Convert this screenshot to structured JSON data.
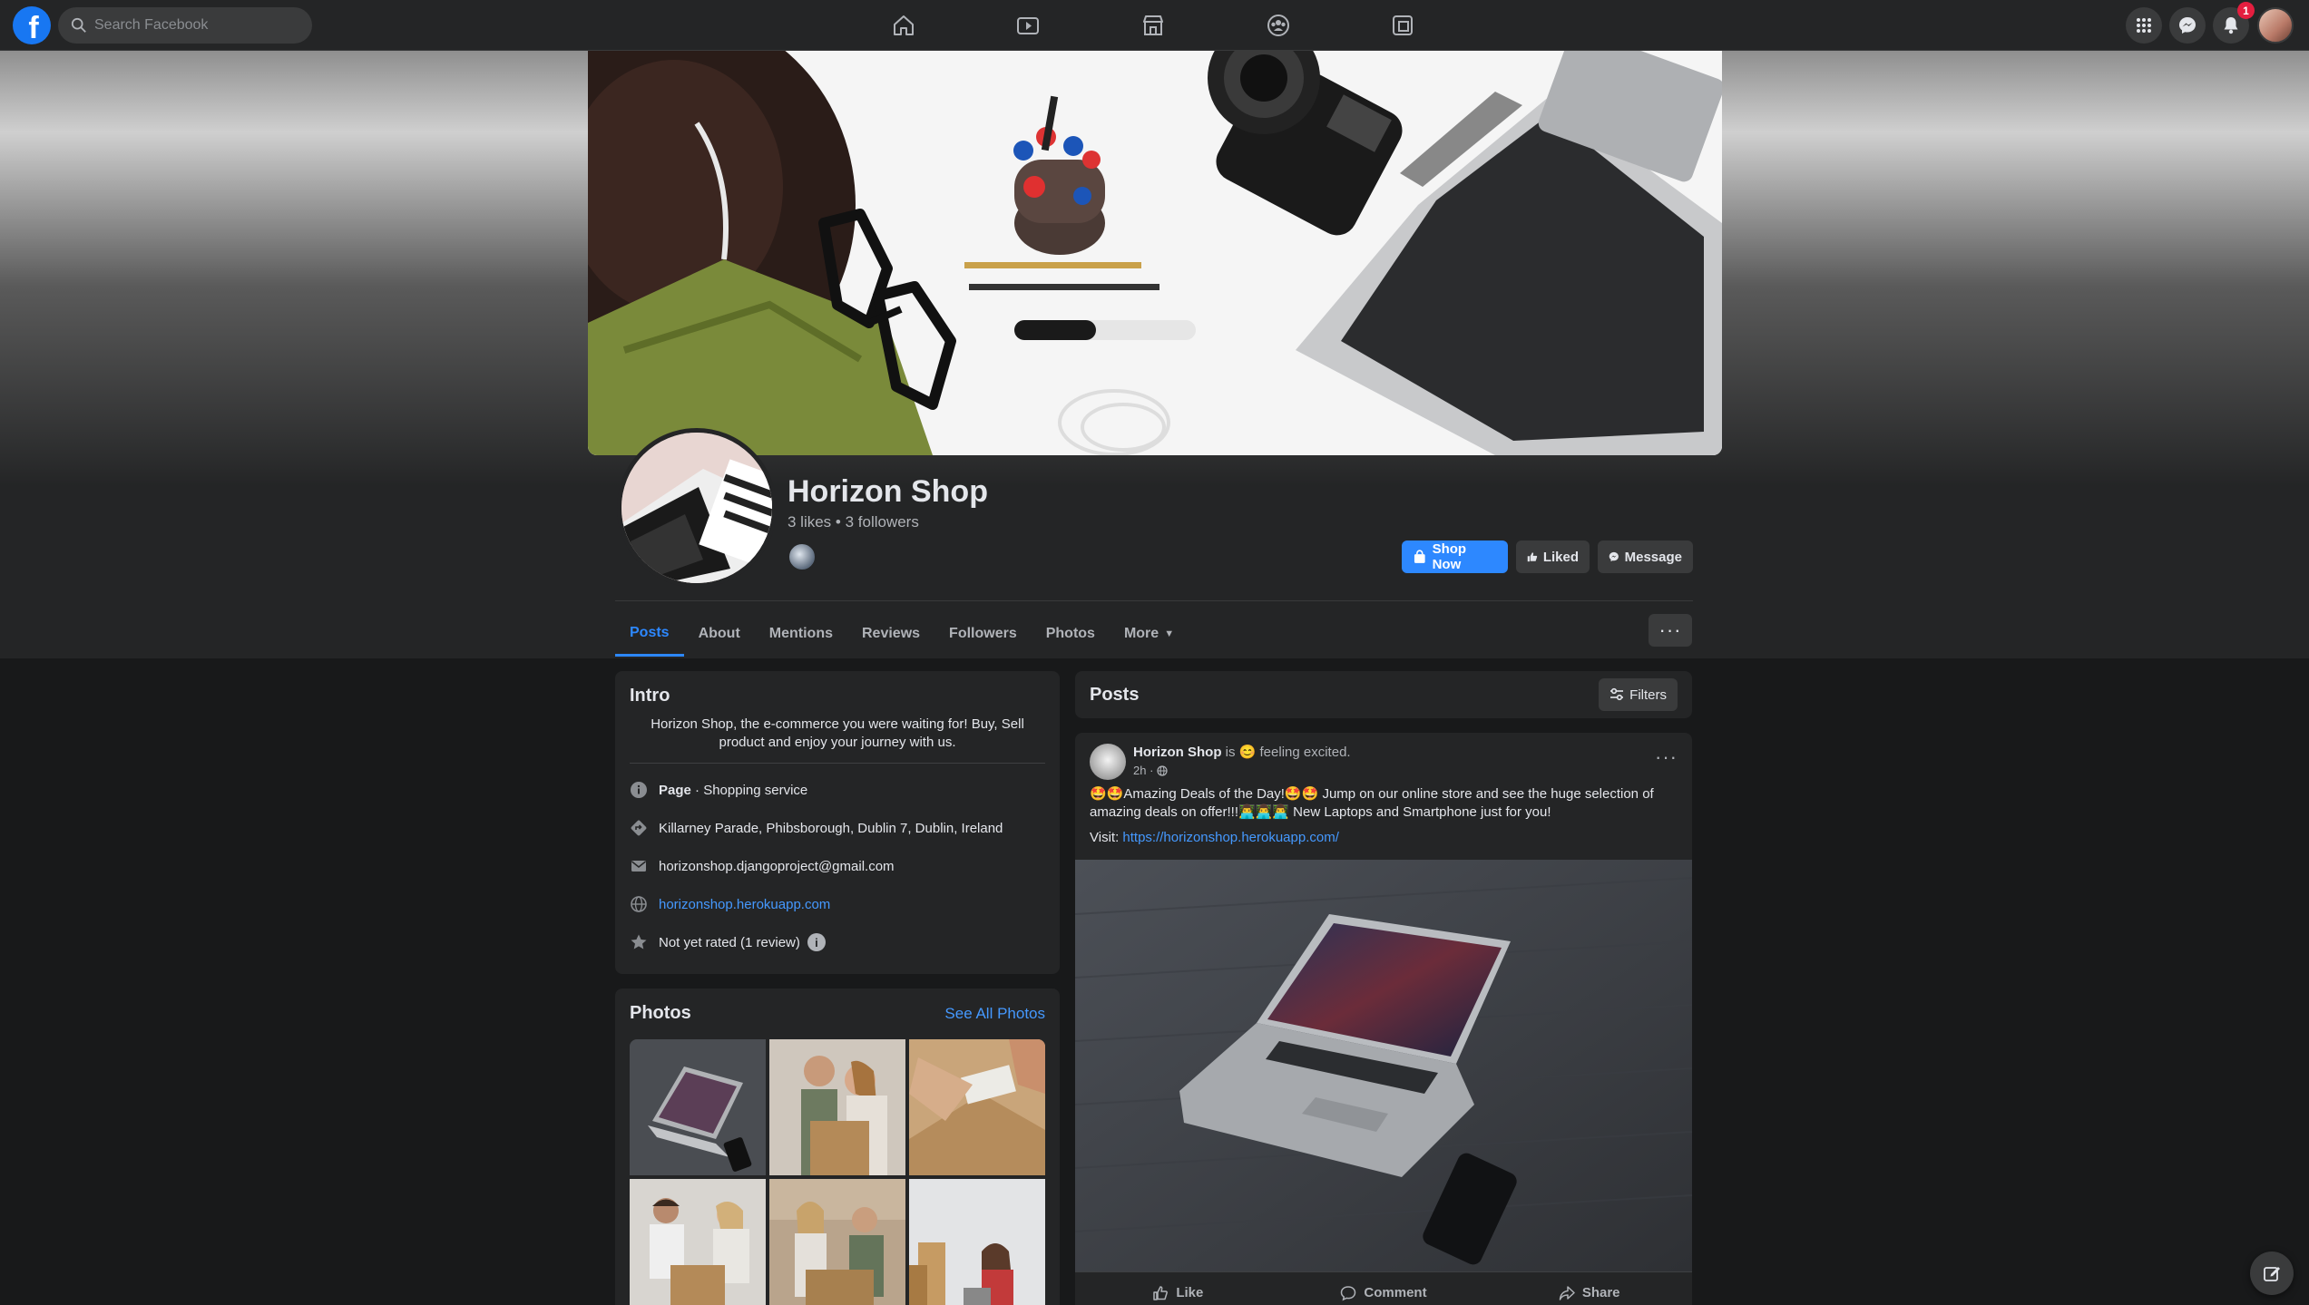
{
  "topnav": {
    "search_placeholder": "Search Facebook",
    "notification_count": "1",
    "nav_tabs": [
      "home-icon",
      "watch-icon",
      "marketplace-icon",
      "groups-icon",
      "gaming-icon"
    ],
    "right_icons": [
      "menu-grid-icon",
      "messenger-icon",
      "notifications-icon",
      "account-avatar"
    ]
  },
  "page": {
    "name": "Horizon Shop",
    "stats": "3 likes • 3 followers",
    "actions": {
      "shop": "Shop Now",
      "liked": "Liked",
      "message": "Message"
    },
    "tabs": [
      "Posts",
      "About",
      "Mentions",
      "Reviews",
      "Followers",
      "Photos",
      "More"
    ],
    "active_tab": "Posts",
    "more_options": "···"
  },
  "intro": {
    "title": "Intro",
    "bio": "Horizon Shop, the e-commerce you were waiting for! Buy, Sell product and enjoy your journey with us.",
    "category_prefix": "Page",
    "category": " · Shopping service",
    "address": "Killarney Parade, Phibsborough, Dublin 7, Dublin, Ireland",
    "email": "horizonshop.djangoproject@gmail.com",
    "website": "horizonshop.herokuapp.com",
    "rating": "Not yet rated (1 review)"
  },
  "photos": {
    "title": "Photos",
    "see_all": "See All Photos"
  },
  "posts": {
    "title": "Posts",
    "filters": "Filters",
    "post": {
      "author": "Horizon Shop",
      "feeling": " is 😊 feeling excited.",
      "time": "2h ·",
      "text": "🤩🤩Amazing Deals of the Day!🤩🤩 Jump on our online store and see the huge selection of amazing deals on offer!!!👨‍💻👨‍💻👨‍💻 New Laptops and Smartphone just for you!",
      "visit_label": "Visit: ",
      "visit_url": "https://horizonshop.herokuapp.com/",
      "actions": {
        "like": "Like",
        "comment": "Comment",
        "share": "Share"
      }
    }
  },
  "colors": {
    "accent": "#2d88ff",
    "surface": "#242526",
    "background": "#18191a",
    "notification": "#e41e3f"
  }
}
